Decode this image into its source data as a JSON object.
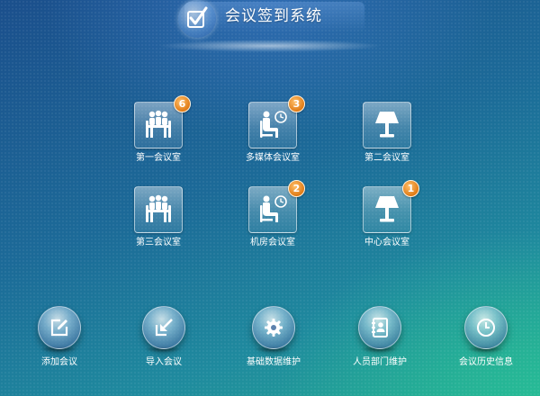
{
  "app": {
    "title": "会议签到系统",
    "logo_icon": "checkbox-icon"
  },
  "rooms": [
    {
      "label": "第一会议室",
      "icon": "meeting-table-icon",
      "badge": "6"
    },
    {
      "label": "多媒体会议室",
      "icon": "seated-person-clock-icon",
      "badge": "3"
    },
    {
      "label": "第二会议室",
      "icon": "lamp-icon",
      "badge": ""
    },
    {
      "label": "第三会议室",
      "icon": "meeting-table-icon",
      "badge": ""
    },
    {
      "label": "机房会议室",
      "icon": "seated-person-clock-icon",
      "badge": "2"
    },
    {
      "label": "中心会议室",
      "icon": "lamp-icon",
      "badge": "1"
    }
  ],
  "actions": [
    {
      "label": "添加会议",
      "icon": "edit-icon"
    },
    {
      "label": "导入会议",
      "icon": "import-icon"
    },
    {
      "label": "基础数据维护",
      "icon": "gear-icon"
    },
    {
      "label": "人员部门维护",
      "icon": "contacts-icon"
    },
    {
      "label": "会议历史信息",
      "icon": "clock-icon"
    }
  ],
  "colors": {
    "badge": "#e58a1f",
    "background_top": "#1b4f8c",
    "background_bottom": "#23a893"
  }
}
